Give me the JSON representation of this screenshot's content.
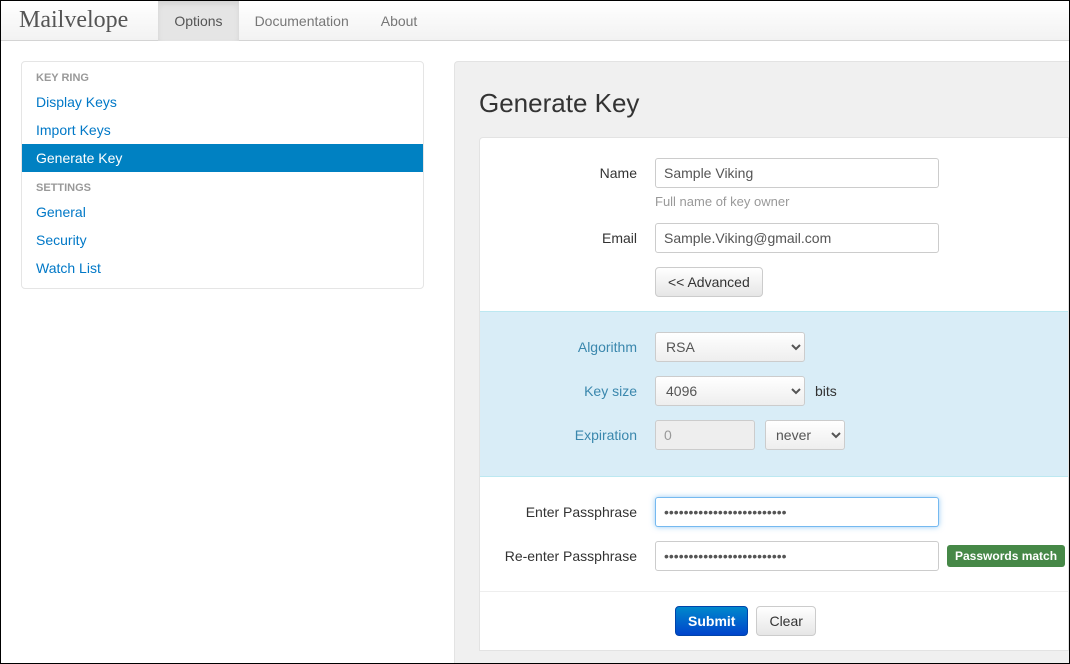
{
  "brand": "Mailvelope",
  "nav": [
    {
      "label": "Options",
      "active": true
    },
    {
      "label": "Documentation",
      "active": false
    },
    {
      "label": "About",
      "active": false
    }
  ],
  "sidebar": {
    "groups": [
      {
        "header": "Key Ring",
        "items": [
          {
            "label": "Display Keys",
            "active": false
          },
          {
            "label": "Import Keys",
            "active": false
          },
          {
            "label": "Generate Key",
            "active": true
          }
        ]
      },
      {
        "header": "Settings",
        "items": [
          {
            "label": "General",
            "active": false
          },
          {
            "label": "Security",
            "active": false
          },
          {
            "label": "Watch List",
            "active": false
          }
        ]
      }
    ]
  },
  "page": {
    "title": "Generate Key",
    "name_label": "Name",
    "name_value": "Sample Viking",
    "name_help": "Full name of key owner",
    "email_label": "Email",
    "email_value": "Sample.Viking@gmail.com",
    "advanced_btn": "<< Advanced",
    "algorithm_label": "Algorithm",
    "algorithm_value": "RSA",
    "keysize_label": "Key size",
    "keysize_value": "4096",
    "keysize_unit": "bits",
    "expiration_label": "Expiration",
    "expiration_value": "0",
    "expiration_unit": "never",
    "pass1_label": "Enter Passphrase",
    "pass1_value": "•••••••••••••••••••••••••",
    "pass2_label": "Re-enter Passphrase",
    "pass2_value": "•••••••••••••••••••••••••",
    "match_badge": "Passwords match",
    "submit": "Submit",
    "clear": "Clear"
  }
}
